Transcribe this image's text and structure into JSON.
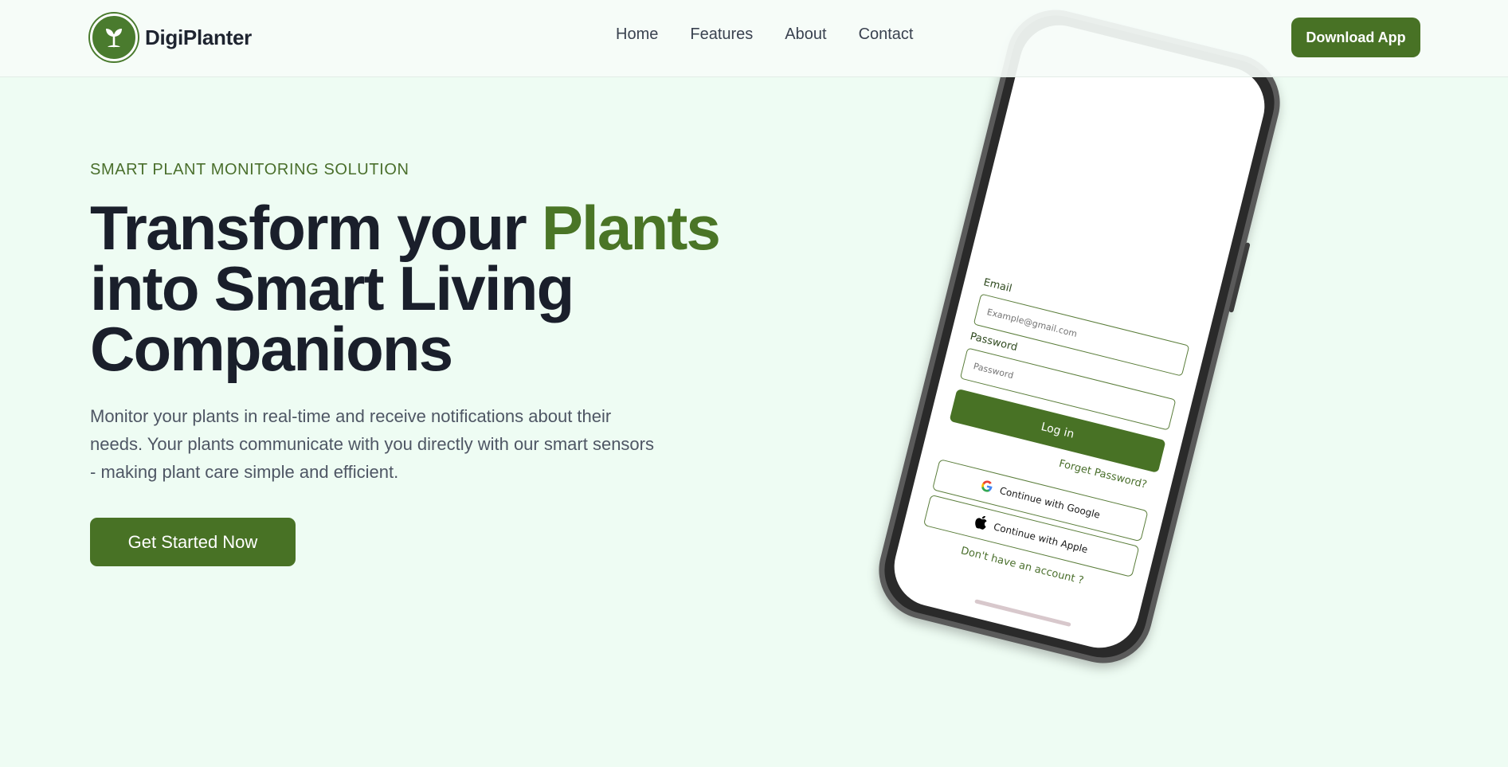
{
  "brand": {
    "name": "DigiPlanter"
  },
  "nav": {
    "items": [
      {
        "label": "Home"
      },
      {
        "label": "Features"
      },
      {
        "label": "About"
      },
      {
        "label": "Contact"
      }
    ]
  },
  "header": {
    "download_label": "Download App"
  },
  "hero": {
    "eyebrow": "SMART PLANT MONITORING SOLUTION",
    "title_part1": "Transform your ",
    "title_accent": "Plants",
    "title_part2": "into Smart Living Companions",
    "description": "Monitor your plants in real-time and receive notifications about their needs. Your plants communicate with you directly with our smart sensors - making plant care simple and efficient.",
    "cta_label": "Get Started Now"
  },
  "phone_login": {
    "email_label": "Email",
    "email_placeholder": "Example@gmail.com",
    "password_label": "Password",
    "password_placeholder": "Password",
    "login_label": "Log in",
    "forgot_label": "Forget Password?",
    "google_label": "Continue with Google",
    "apple_label": "Continue with Apple",
    "signup_label": "Don't have an account ?"
  },
  "colors": {
    "accent": "#487225",
    "background": "#eefcf3",
    "heading": "#1a1f2b"
  }
}
